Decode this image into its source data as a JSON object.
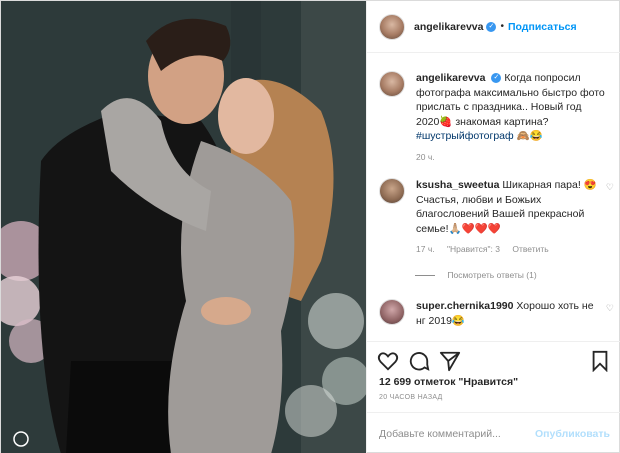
{
  "post": {
    "author": "angelikarevva",
    "follow_label": "Подписаться",
    "caption": "Когда попросил фотографа максимально быстро фото прислать с праздника.. Новый год 2020🍓 знакомая картина?",
    "hashtag": "#шустрыйфотограф",
    "caption_emoji": "🙈😂",
    "time": "20 ч."
  },
  "comments": [
    {
      "user": "ksusha_sweetua",
      "text": "Шикарная пара! 😍Счастья, любви и Божьих благословений Вашей прекрасной семье!🙏🏼❤️❤️❤️",
      "time": "17 ч.",
      "likes": "\"Нравится\": 3",
      "reply": "Ответить"
    },
    {
      "user": "super.chernika1990",
      "text": "Хорошо хоть не нг 2019😂"
    }
  ],
  "view_replies": "Посмотреть ответы (1)",
  "likes_count": "12 699 отметок \"Нравится\"",
  "posted_ago": "20 ЧАСОВ НАЗАД",
  "add_comment_placeholder": "Добавьте комментарий...",
  "publish_label": "Опубликовать",
  "icons": [
    "heart-icon",
    "comment-icon",
    "share-icon",
    "bookmark-icon",
    "verified-icon",
    "small-heart-icon"
  ],
  "colors": {
    "accent": "#0095f6",
    "verified": "#3897f0",
    "muted": "#8e8e8e"
  }
}
